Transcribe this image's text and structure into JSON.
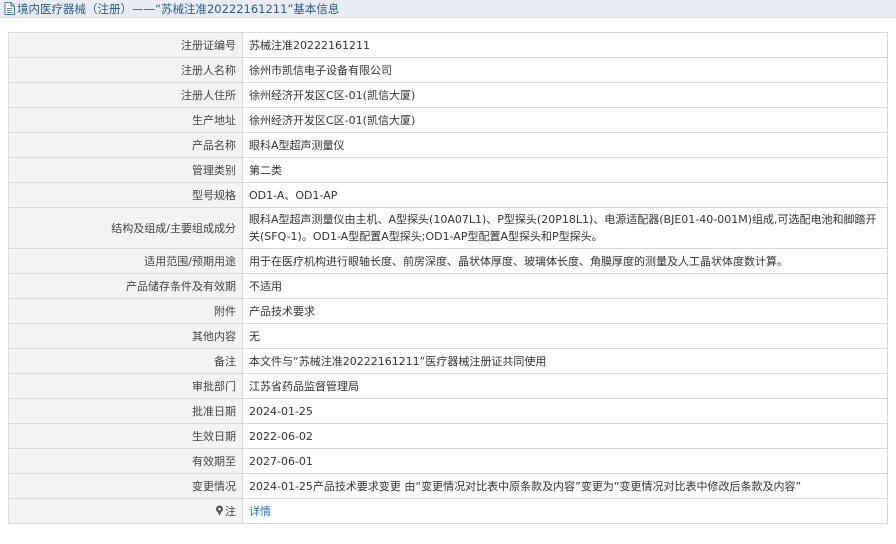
{
  "header": {
    "title": "境内医疗器械（注册）——“苏械注准20222161211”基本信息"
  },
  "rows": [
    {
      "label": "注册证编号",
      "value": "苏械注准20222161211"
    },
    {
      "label": "注册人名称",
      "value": "徐州市凯信电子设备有限公司"
    },
    {
      "label": "注册人住所",
      "value": "徐州经济开发区C区-01(凯信大厦)"
    },
    {
      "label": "生产地址",
      "value": "徐州经济开发区C区-01(凯信大厦)"
    },
    {
      "label": "产品名称",
      "value": "眼科A型超声测量仪"
    },
    {
      "label": "管理类别",
      "value": "第二类"
    },
    {
      "label": "型号规格",
      "value": "OD1-A、OD1-AP"
    },
    {
      "label": "结构及组成/主要组成成分",
      "value": "眼科A型超声测量仪由主机、A型探头(10A07L1)、P型探头(20P18L1)、电源适配器(BJE01-40-001M)组成,可选配电池和脚踏开关(SFQ-1)。OD1-A型配置A型探头;OD1-AP型配置A型探头和P型探头。"
    },
    {
      "label": "适用范围/预期用途",
      "value": "用于在医疗机构进行眼轴长度、前房深度、晶状体厚度、玻璃体长度、角膜厚度的测量及人工晶状体度数计算。"
    },
    {
      "label": "产品储存条件及有效期",
      "value": "不适用"
    },
    {
      "label": "附件",
      "value": "产品技术要求"
    },
    {
      "label": "其他内容",
      "value": "无"
    },
    {
      "label": "备注",
      "value": "本文件与“苏械注准20222161211”医疗器械注册证共同使用"
    },
    {
      "label": "审批部门",
      "value": "江苏省药品监督管理局"
    },
    {
      "label": "批准日期",
      "value": "2024-01-25"
    },
    {
      "label": "生效日期",
      "value": "2022-06-02"
    },
    {
      "label": "有效期至",
      "value": "2027-06-01"
    },
    {
      "label": "变更情况",
      "value": "2024-01-25产品技术要求变更 由“变更情况对比表中原条款及内容”变更为“变更情况对比表中修改后条款及内容”"
    }
  ],
  "note": {
    "label": "注",
    "link_text": "详情",
    "icon": "pin-icon"
  },
  "colors": {
    "title_text": "#2b5a8c",
    "title_bar_bg": "#e8edf3",
    "label_bg": "#f3f3f3",
    "border": "#d8d8d8",
    "link": "#2f6fb3"
  }
}
